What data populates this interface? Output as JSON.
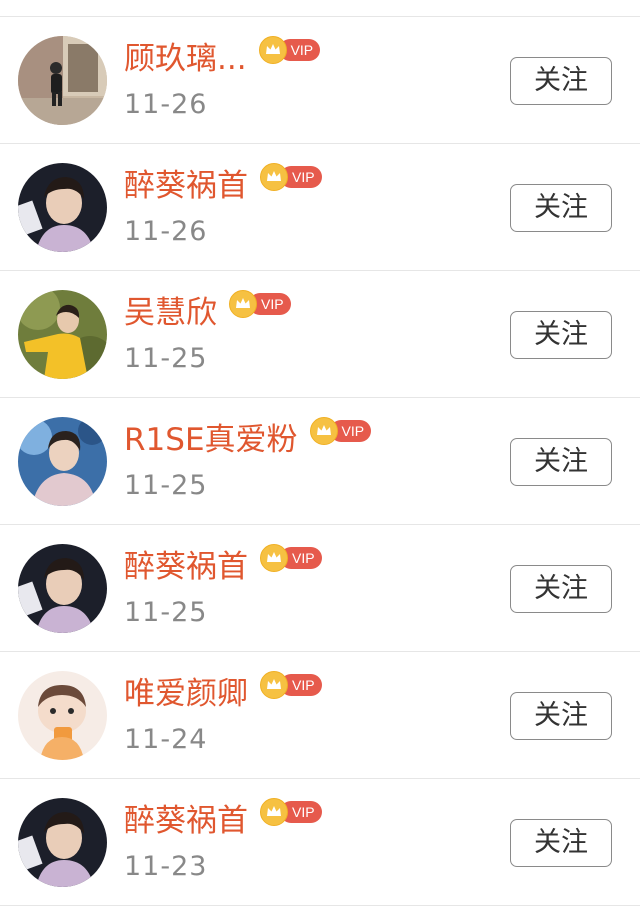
{
  "vip_label": "VIP",
  "follow_label": "关注",
  "colors": {
    "name": "#e0572f",
    "date": "#888888",
    "vip_pill": "#e65a4c",
    "crown": "#f6c142",
    "divider": "#e6e6e6"
  },
  "rows": [
    {
      "name": "顾玖璃...",
      "date": "11-26",
      "vip": true,
      "avatar": "photo-girl-walking"
    },
    {
      "name": "醉葵祸首",
      "date": "11-26",
      "vip": true,
      "avatar": "photo-young-man"
    },
    {
      "name": "吴慧欣",
      "date": "11-25",
      "vip": true,
      "avatar": "photo-man-yellow-hoodie"
    },
    {
      "name": "R1SE真爱粉",
      "date": "11-25",
      "vip": true,
      "avatar": "photo-man-blue-background"
    },
    {
      "name": "醉葵祸首",
      "date": "11-25",
      "vip": true,
      "avatar": "photo-young-man"
    },
    {
      "name": "唯爱颜卿",
      "date": "11-24",
      "vip": true,
      "avatar": "photo-cartoon-child"
    },
    {
      "name": "醉葵祸首",
      "date": "11-23",
      "vip": true,
      "avatar": "photo-young-man"
    }
  ]
}
